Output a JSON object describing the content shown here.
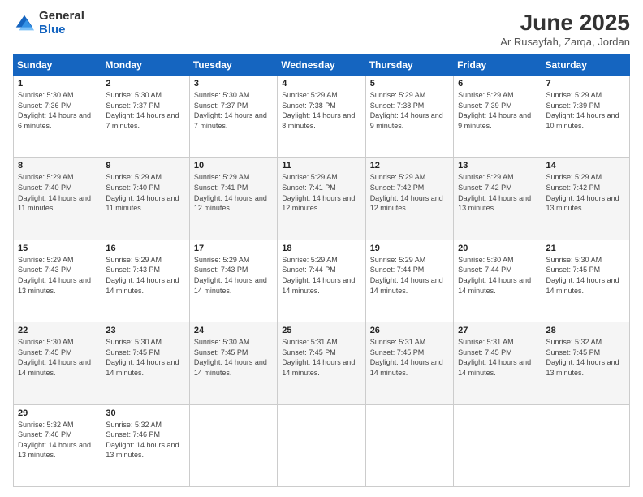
{
  "logo": {
    "general": "General",
    "blue": "Blue"
  },
  "title": "June 2025",
  "subtitle": "Ar Rusayfah, Zarqa, Jordan",
  "headers": [
    "Sunday",
    "Monday",
    "Tuesday",
    "Wednesday",
    "Thursday",
    "Friday",
    "Saturday"
  ],
  "weeks": [
    [
      {
        "day": "1",
        "sunrise": "5:30 AM",
        "sunset": "7:36 PM",
        "daylight": "14 hours and 6 minutes."
      },
      {
        "day": "2",
        "sunrise": "5:30 AM",
        "sunset": "7:37 PM",
        "daylight": "14 hours and 7 minutes."
      },
      {
        "day": "3",
        "sunrise": "5:30 AM",
        "sunset": "7:37 PM",
        "daylight": "14 hours and 7 minutes."
      },
      {
        "day": "4",
        "sunrise": "5:29 AM",
        "sunset": "7:38 PM",
        "daylight": "14 hours and 8 minutes."
      },
      {
        "day": "5",
        "sunrise": "5:29 AM",
        "sunset": "7:38 PM",
        "daylight": "14 hours and 9 minutes."
      },
      {
        "day": "6",
        "sunrise": "5:29 AM",
        "sunset": "7:39 PM",
        "daylight": "14 hours and 9 minutes."
      },
      {
        "day": "7",
        "sunrise": "5:29 AM",
        "sunset": "7:39 PM",
        "daylight": "14 hours and 10 minutes."
      }
    ],
    [
      {
        "day": "8",
        "sunrise": "5:29 AM",
        "sunset": "7:40 PM",
        "daylight": "14 hours and 11 minutes."
      },
      {
        "day": "9",
        "sunrise": "5:29 AM",
        "sunset": "7:40 PM",
        "daylight": "14 hours and 11 minutes."
      },
      {
        "day": "10",
        "sunrise": "5:29 AM",
        "sunset": "7:41 PM",
        "daylight": "14 hours and 12 minutes."
      },
      {
        "day": "11",
        "sunrise": "5:29 AM",
        "sunset": "7:41 PM",
        "daylight": "14 hours and 12 minutes."
      },
      {
        "day": "12",
        "sunrise": "5:29 AM",
        "sunset": "7:42 PM",
        "daylight": "14 hours and 12 minutes."
      },
      {
        "day": "13",
        "sunrise": "5:29 AM",
        "sunset": "7:42 PM",
        "daylight": "14 hours and 13 minutes."
      },
      {
        "day": "14",
        "sunrise": "5:29 AM",
        "sunset": "7:42 PM",
        "daylight": "14 hours and 13 minutes."
      }
    ],
    [
      {
        "day": "15",
        "sunrise": "5:29 AM",
        "sunset": "7:43 PM",
        "daylight": "14 hours and 13 minutes."
      },
      {
        "day": "16",
        "sunrise": "5:29 AM",
        "sunset": "7:43 PM",
        "daylight": "14 hours and 14 minutes."
      },
      {
        "day": "17",
        "sunrise": "5:29 AM",
        "sunset": "7:43 PM",
        "daylight": "14 hours and 14 minutes."
      },
      {
        "day": "18",
        "sunrise": "5:29 AM",
        "sunset": "7:44 PM",
        "daylight": "14 hours and 14 minutes."
      },
      {
        "day": "19",
        "sunrise": "5:29 AM",
        "sunset": "7:44 PM",
        "daylight": "14 hours and 14 minutes."
      },
      {
        "day": "20",
        "sunrise": "5:30 AM",
        "sunset": "7:44 PM",
        "daylight": "14 hours and 14 minutes."
      },
      {
        "day": "21",
        "sunrise": "5:30 AM",
        "sunset": "7:45 PM",
        "daylight": "14 hours and 14 minutes."
      }
    ],
    [
      {
        "day": "22",
        "sunrise": "5:30 AM",
        "sunset": "7:45 PM",
        "daylight": "14 hours and 14 minutes."
      },
      {
        "day": "23",
        "sunrise": "5:30 AM",
        "sunset": "7:45 PM",
        "daylight": "14 hours and 14 minutes."
      },
      {
        "day": "24",
        "sunrise": "5:30 AM",
        "sunset": "7:45 PM",
        "daylight": "14 hours and 14 minutes."
      },
      {
        "day": "25",
        "sunrise": "5:31 AM",
        "sunset": "7:45 PM",
        "daylight": "14 hours and 14 minutes."
      },
      {
        "day": "26",
        "sunrise": "5:31 AM",
        "sunset": "7:45 PM",
        "daylight": "14 hours and 14 minutes."
      },
      {
        "day": "27",
        "sunrise": "5:31 AM",
        "sunset": "7:45 PM",
        "daylight": "14 hours and 14 minutes."
      },
      {
        "day": "28",
        "sunrise": "5:32 AM",
        "sunset": "7:45 PM",
        "daylight": "14 hours and 13 minutes."
      }
    ],
    [
      {
        "day": "29",
        "sunrise": "5:32 AM",
        "sunset": "7:46 PM",
        "daylight": "14 hours and 13 minutes."
      },
      {
        "day": "30",
        "sunrise": "5:32 AM",
        "sunset": "7:46 PM",
        "daylight": "14 hours and 13 minutes."
      },
      null,
      null,
      null,
      null,
      null
    ]
  ],
  "labels": {
    "sunrise": "Sunrise:",
    "sunset": "Sunset:",
    "daylight": "Daylight:"
  }
}
